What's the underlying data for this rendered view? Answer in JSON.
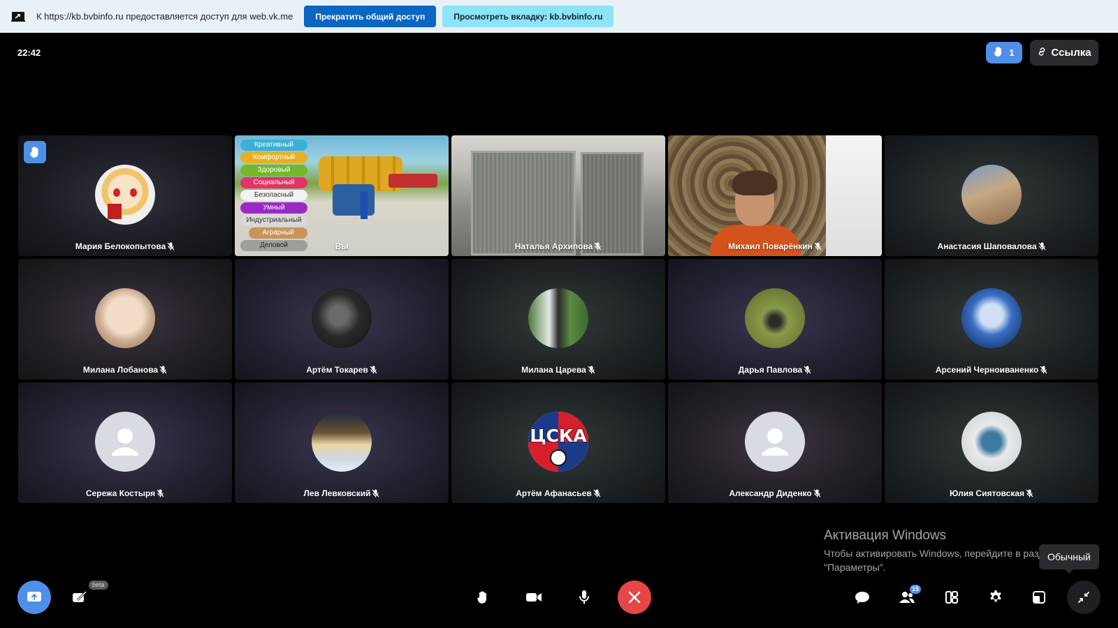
{
  "share_bar": {
    "text": "К https://kb.bvbinfo.ru предоставляется доступ для web.vk.me",
    "stop_label": "Прекратить общий доступ",
    "view_label": "Просмотреть вкладку: kb.bvbinfo.ru"
  },
  "header": {
    "clock": "22:42",
    "raised_hands": "1",
    "link_label": "Ссылка"
  },
  "game": {
    "categories": [
      {
        "label": "Креативный",
        "color": "#3ab0d6"
      },
      {
        "label": "Комфортный",
        "color": "#e8b020"
      },
      {
        "label": "Здоровый",
        "color": "#73b829"
      },
      {
        "label": "Социальный",
        "color": "#e0346a"
      },
      {
        "label": "Безопасный",
        "color": "#f2f2f2"
      },
      {
        "label": "Умный",
        "color": "#9a2ac4"
      },
      {
        "label": "Индустриальный",
        "color": "#d9d9d9"
      },
      {
        "label": "Аграрный",
        "color": "#c9935a"
      },
      {
        "label": "Деловой",
        "color": "#9e9e9e"
      }
    ]
  },
  "participants": [
    {
      "name": "Мария Белокопытова",
      "hand": true
    },
    {
      "name": "Вы"
    },
    {
      "name": "Наталья Архипова"
    },
    {
      "name": "Михаил Поварёнкин"
    },
    {
      "name": "Анастасия Шаповалова"
    },
    {
      "name": "Милана Лобанова"
    },
    {
      "name": "Артём Токарев"
    },
    {
      "name": "Милана Царева"
    },
    {
      "name": "Дарья Павлова"
    },
    {
      "name": "Арсений Черноиваненко"
    },
    {
      "name": "Сережа Костыря"
    },
    {
      "name": "Лев Левковский"
    },
    {
      "name": "Артём Афанасьев",
      "avatar_text": "ЦСКА"
    },
    {
      "name": "Александр Диденко"
    },
    {
      "name": "Юлия Сиятовская"
    }
  ],
  "watermark": {
    "title": "Активация Windows",
    "line1": "Чтобы активировать Windows, перейдите в раздел",
    "line2": "\"Параметры\"."
  },
  "tooltip": "Обычный",
  "controls": {
    "beta_label": "beta",
    "participants_count": "15"
  },
  "colors": {
    "accent": "#4f8fe8",
    "end_call": "#e64646",
    "share_stop": "#0a66c2",
    "share_view": "#8ee4f7"
  }
}
